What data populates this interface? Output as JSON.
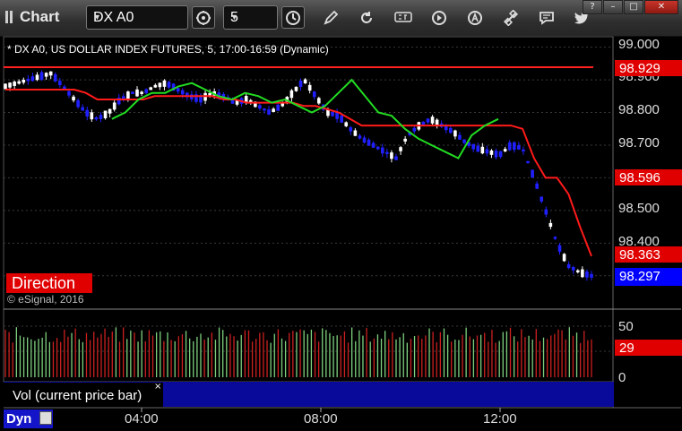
{
  "toolbar": {
    "title": "Chart",
    "symbol": "DX A0",
    "interval": "5",
    "icons": [
      "clock-settings-icon",
      "clock-icon",
      "pencil-icon",
      "refresh-icon",
      "get-icon",
      "play-icon",
      "alert-icon",
      "link-icon",
      "chat-icon",
      "twitter-icon"
    ],
    "window_buttons": [
      "?",
      "–",
      "□",
      "✕"
    ]
  },
  "chart": {
    "description": "* DX A0, US DOLLAR INDEX FUTURES, 5, 17:00-16:59 (Dynamic)",
    "direction_label": "Direction",
    "copyright": "© eSignal, 2016",
    "price_axis": [
      "99.000",
      "98.900",
      "98.800",
      "98.700",
      "98.500",
      "98.400"
    ],
    "price_tags": {
      "upper_line": "98.929",
      "ma_slow": "98.596",
      "ma_fast": "98.363",
      "last": "98.297"
    },
    "volume_axis": [
      "50",
      "0"
    ],
    "volume_tag": "29",
    "volume_label": "Vol (current price bar)",
    "volume_close": "×",
    "time_axis": [
      "04:00",
      "08:00",
      "12:00"
    ],
    "mode": "Dyn",
    "colors": {
      "background": "#000000",
      "up_candle": "#ffffff",
      "down_candle": "#1a1aff",
      "ma_slow": "#ff0000",
      "ma_fast": "#00cc00",
      "level_line": "#ff0000",
      "tag_red": "#e00000",
      "tag_blue": "#0000ff"
    }
  },
  "chart_data": {
    "type": "line",
    "series": [
      {
        "name": "",
        "values": [
          98.88,
          98.89,
          98.9,
          98.91,
          98.92,
          98.88,
          98.84,
          98.8,
          98.78,
          98.8,
          98.84,
          98.86,
          98.86,
          98.88,
          98.89,
          98.87,
          98.85,
          98.84,
          98.86,
          98.85,
          98.83,
          98.84,
          98.82,
          98.8,
          98.82,
          98.86,
          98.9,
          98.85,
          98.8,
          98.79,
          98.75,
          98.72,
          98.7,
          98.68,
          98.66,
          98.73,
          98.76,
          98.78,
          98.76,
          98.74,
          98.71,
          98.69,
          98.68,
          98.67,
          98.7,
          98.69,
          98.6,
          98.5,
          98.4,
          98.33,
          98.31,
          98.3
        ]
      },
      {
        "name": "",
        "values": [
          98.87,
          98.87,
          98.87,
          98.87,
          98.87,
          98.87,
          98.87,
          98.86,
          98.84,
          98.84,
          98.84,
          98.84,
          98.84,
          98.85,
          98.85,
          98.85,
          98.85,
          98.85,
          98.85,
          98.84,
          98.84,
          98.83,
          98.83,
          98.83,
          98.83,
          98.83,
          98.82,
          98.82,
          98.81,
          98.8,
          98.78,
          98.76,
          98.76,
          98.76,
          98.76,
          98.76,
          98.76,
          98.76,
          98.76,
          98.76,
          98.76,
          98.76,
          98.76,
          98.76,
          98.76,
          98.75,
          98.66,
          98.6,
          98.6,
          98.55,
          98.45,
          98.36
        ]
      }
    ],
    "ylim": [
      98.25,
      99.01
    ]
  }
}
